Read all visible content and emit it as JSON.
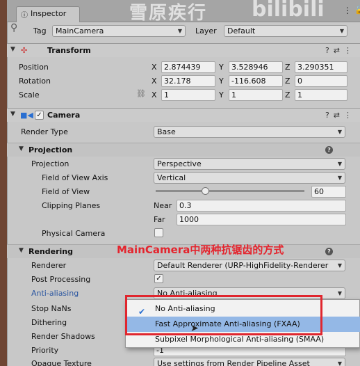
{
  "tab": {
    "label": "Inspector"
  },
  "watermark": {
    "text": "雪原疾行",
    "text2": "bilibili"
  },
  "header": {
    "tag_label": "Tag",
    "tag_value": "MainCamera",
    "layer_label": "Layer",
    "layer_value": "Default"
  },
  "transform": {
    "title": "Transform",
    "position": {
      "label": "Position",
      "x": "2.874439",
      "y": "3.528946",
      "z": "3.290351"
    },
    "rotation": {
      "label": "Rotation",
      "x": "32.178",
      "y": "-116.608",
      "z": "0"
    },
    "scale": {
      "label": "Scale",
      "x": "1",
      "y": "1",
      "z": "1"
    },
    "axis_x": "X",
    "axis_y": "Y",
    "axis_z": "Z"
  },
  "camera": {
    "title": "Camera",
    "render_type_label": "Render Type",
    "render_type_value": "Base",
    "projection_section": "Projection",
    "projection_label": "Projection",
    "projection_value": "Perspective",
    "fov_axis_label": "Field of View Axis",
    "fov_axis_value": "Vertical",
    "fov_label": "Field of View",
    "fov_value": "60",
    "fov_fraction": 0.33,
    "clipping_label": "Clipping Planes",
    "near_label": "Near",
    "near_value": "0.3",
    "far_label": "Far",
    "far_value": "1000",
    "physical_label": "Physical Camera"
  },
  "rendering": {
    "section": "Rendering",
    "renderer_label": "Renderer",
    "renderer_value": "Default Renderer (URP-HighFidelity-Renderer",
    "post_label": "Post Processing",
    "aa_label": "Anti-aliasing",
    "aa_value": "No Anti-aliasing",
    "stopnans_label": "Stop NaNs",
    "dithering_label": "Dithering",
    "shadows_label": "Render Shadows",
    "priority_label": "Priority",
    "priority_value": "-1",
    "opaque_label": "Opaque Texture",
    "opaque_value": "Use settings from Render Pipeline Asset"
  },
  "annotation": {
    "text": "MainCamera中两种抗锯齿的方式"
  },
  "popup": {
    "options": [
      "No Anti-aliasing",
      "Fast Approximate Anti-aliasing (FXAA)",
      "Subpixel Morphological Anti-aliasing (SMAA)"
    ]
  },
  "colors": {
    "annotation": "#e4242d",
    "highlight": "#94b8e6",
    "aa_label": "#2a55a0"
  }
}
